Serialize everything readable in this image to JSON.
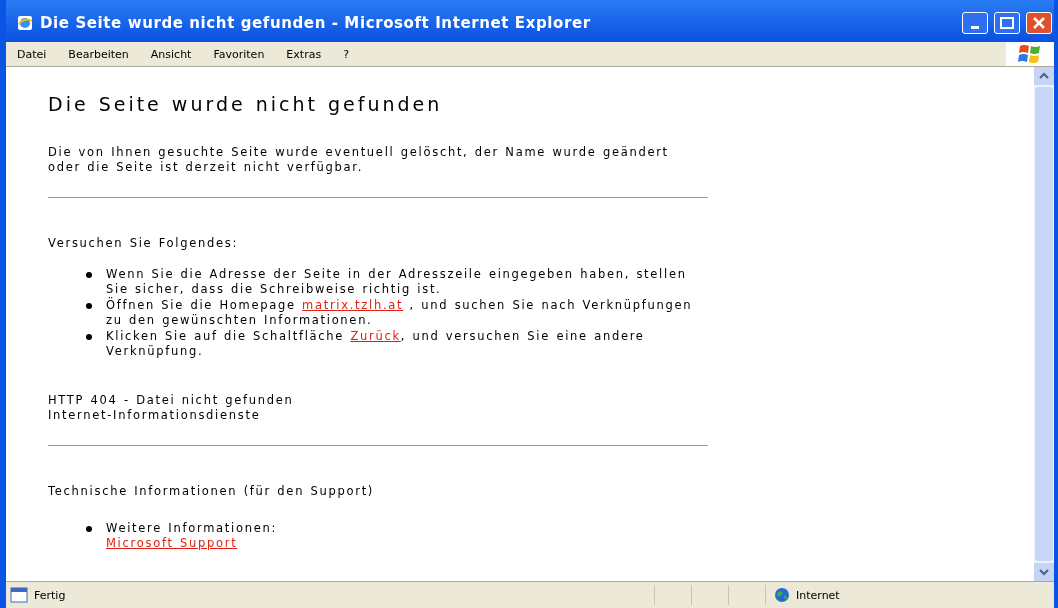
{
  "window": {
    "title": "Die Seite wurde nicht gefunden - Microsoft Internet Explorer"
  },
  "menu": [
    "Datei",
    "Bearbeiten",
    "Ansicht",
    "Favoriten",
    "Extras",
    "?"
  ],
  "page": {
    "heading": "Die Seite wurde nicht gefunden",
    "intro": "Die von Ihnen gesuchte Seite wurde eventuell gelöscht, der Name wurde geändert oder die Seite ist derzeit nicht verfügbar.",
    "try_heading": "Versuchen Sie Folgendes:",
    "suggestions": [
      {
        "before": "Wenn Sie die Adresse der Seite in der Adresszeile eingegeben haben, stellen Sie sicher, dass die Schreibweise richtig ist."
      },
      {
        "before": "Öffnen Sie die Homepage ",
        "link": "matrix.tzlh.at",
        "after": " , und suchen Sie nach Verknüpfungen zu den gewünschten Informationen."
      },
      {
        "before": "Klicken Sie auf die Schaltfläche ",
        "link": "Zurück",
        "after": ", und versuchen Sie eine andere Verknüpfung."
      }
    ],
    "error_code": "HTTP 404 - Datei nicht gefunden",
    "error_source": "Internet-Informationsdienste",
    "tech_heading": "Technische Informationen (für den Support)",
    "tech_items": [
      {
        "label": "Weitere Informationen:",
        "link": "Microsoft Support"
      }
    ]
  },
  "status_bar": {
    "text": "Fertig",
    "zone": "Internet"
  }
}
